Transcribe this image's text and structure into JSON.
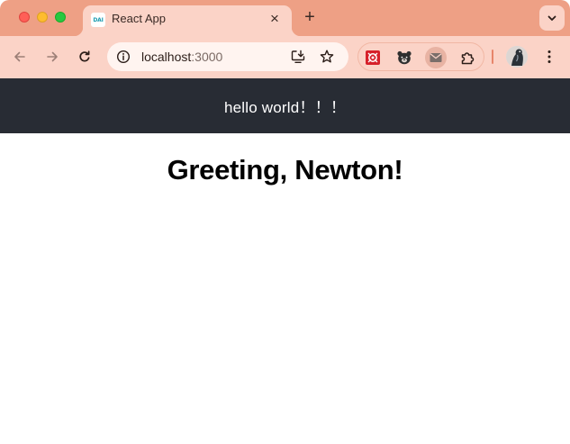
{
  "tab": {
    "title": "React App",
    "favicon_text": "DAI",
    "close_glyph": "×"
  },
  "new_tab_glyph": "+",
  "address_bar": {
    "host": "localhost",
    "port": ":3000"
  },
  "page": {
    "header_text": "hello world！！！",
    "greeting": "Greeting, Newton!"
  },
  "icons": {
    "back": "arrow-left-icon",
    "forward": "arrow-right-icon",
    "reload": "reload-icon",
    "site_info": "info-icon",
    "install": "install-app-icon",
    "bookmark": "star-icon",
    "extensions": "puzzle-icon",
    "menu": "kebab-menu-icon",
    "tab_search": "chevron-down-icon"
  },
  "colors": {
    "tabstrip": "#eea085",
    "toolbar": "#fbd3c7",
    "header_bg": "#282c34",
    "header_text": "#ffffff"
  }
}
